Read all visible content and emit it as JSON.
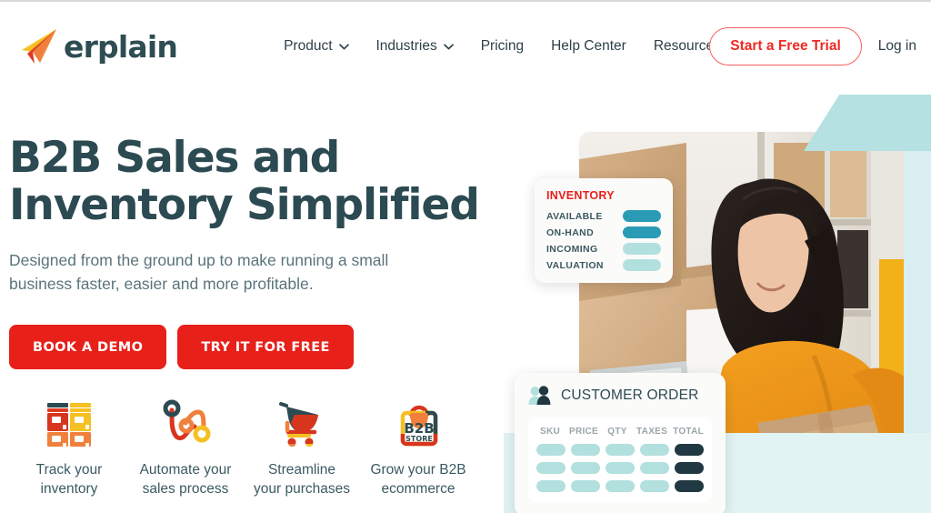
{
  "brand": {
    "name": "erplain",
    "logo_icon": "paper-plane-logo",
    "colors": {
      "red": "#e8201a",
      "red_outline": "#f5635e",
      "dark_slate": "#2c4a51",
      "teal_light": "#b5e1e3",
      "teal_band": "#e1f3f2",
      "pill_teal": "#b2e0de",
      "pill_teal_dark": "#2a9bb5",
      "pill_dark": "#203842"
    }
  },
  "header": {
    "nav": [
      {
        "label": "Product",
        "has_dropdown": true,
        "icon": "chevron-down-icon"
      },
      {
        "label": "Industries",
        "has_dropdown": true,
        "icon": "chevron-down-icon"
      },
      {
        "label": "Pricing",
        "has_dropdown": false,
        "icon": ""
      },
      {
        "label": "Help Center",
        "has_dropdown": false,
        "icon": ""
      },
      {
        "label": "Resources",
        "has_dropdown": true,
        "icon": "chevron-down-icon"
      }
    ],
    "trial_button": "Start a Free Trial",
    "login_link": "Log in"
  },
  "hero": {
    "title_line1": "B2B Sales and",
    "title_line2": "Inventory Simplified",
    "subtitle": "Designed from the ground up to make running a small business faster, easier and more profitable.",
    "cta_primary": "BOOK A DEMO",
    "cta_secondary": "TRY IT FOR FREE"
  },
  "features": [
    {
      "icon": "stacked-boxes-icon",
      "label_line1": "Track your",
      "label_line2": "inventory"
    },
    {
      "icon": "workflow-nodes-icon",
      "label_line1": "Automate your",
      "label_line2": "sales process"
    },
    {
      "icon": "shopping-cart-icon",
      "label_line1": "Streamline",
      "label_line2": "your purchases"
    },
    {
      "icon": "b2b-store-bag-icon",
      "label_line1": "Grow your B2B",
      "label_line2": "ecommerce"
    }
  ],
  "inventory_card": {
    "title": "INVENTORY",
    "rows": [
      {
        "label": "AVAILABLE",
        "bar_color": "#2a9bb5"
      },
      {
        "label": "ON-HAND",
        "bar_color": "#2a9bb5"
      },
      {
        "label": "INCOMING",
        "bar_color": "#b2e0de"
      },
      {
        "label": "VALUATION",
        "bar_color": "#b2e0de"
      }
    ]
  },
  "order_card": {
    "icon": "people-icon",
    "title": "CUSTOMER ORDER",
    "columns": [
      "SKU",
      "PRICE",
      "QTY",
      "TAXES",
      "TOTAL"
    ],
    "row_count": 3
  },
  "photo": {
    "alt": "woman-packing-boxes-at-desk-with-laptop"
  }
}
